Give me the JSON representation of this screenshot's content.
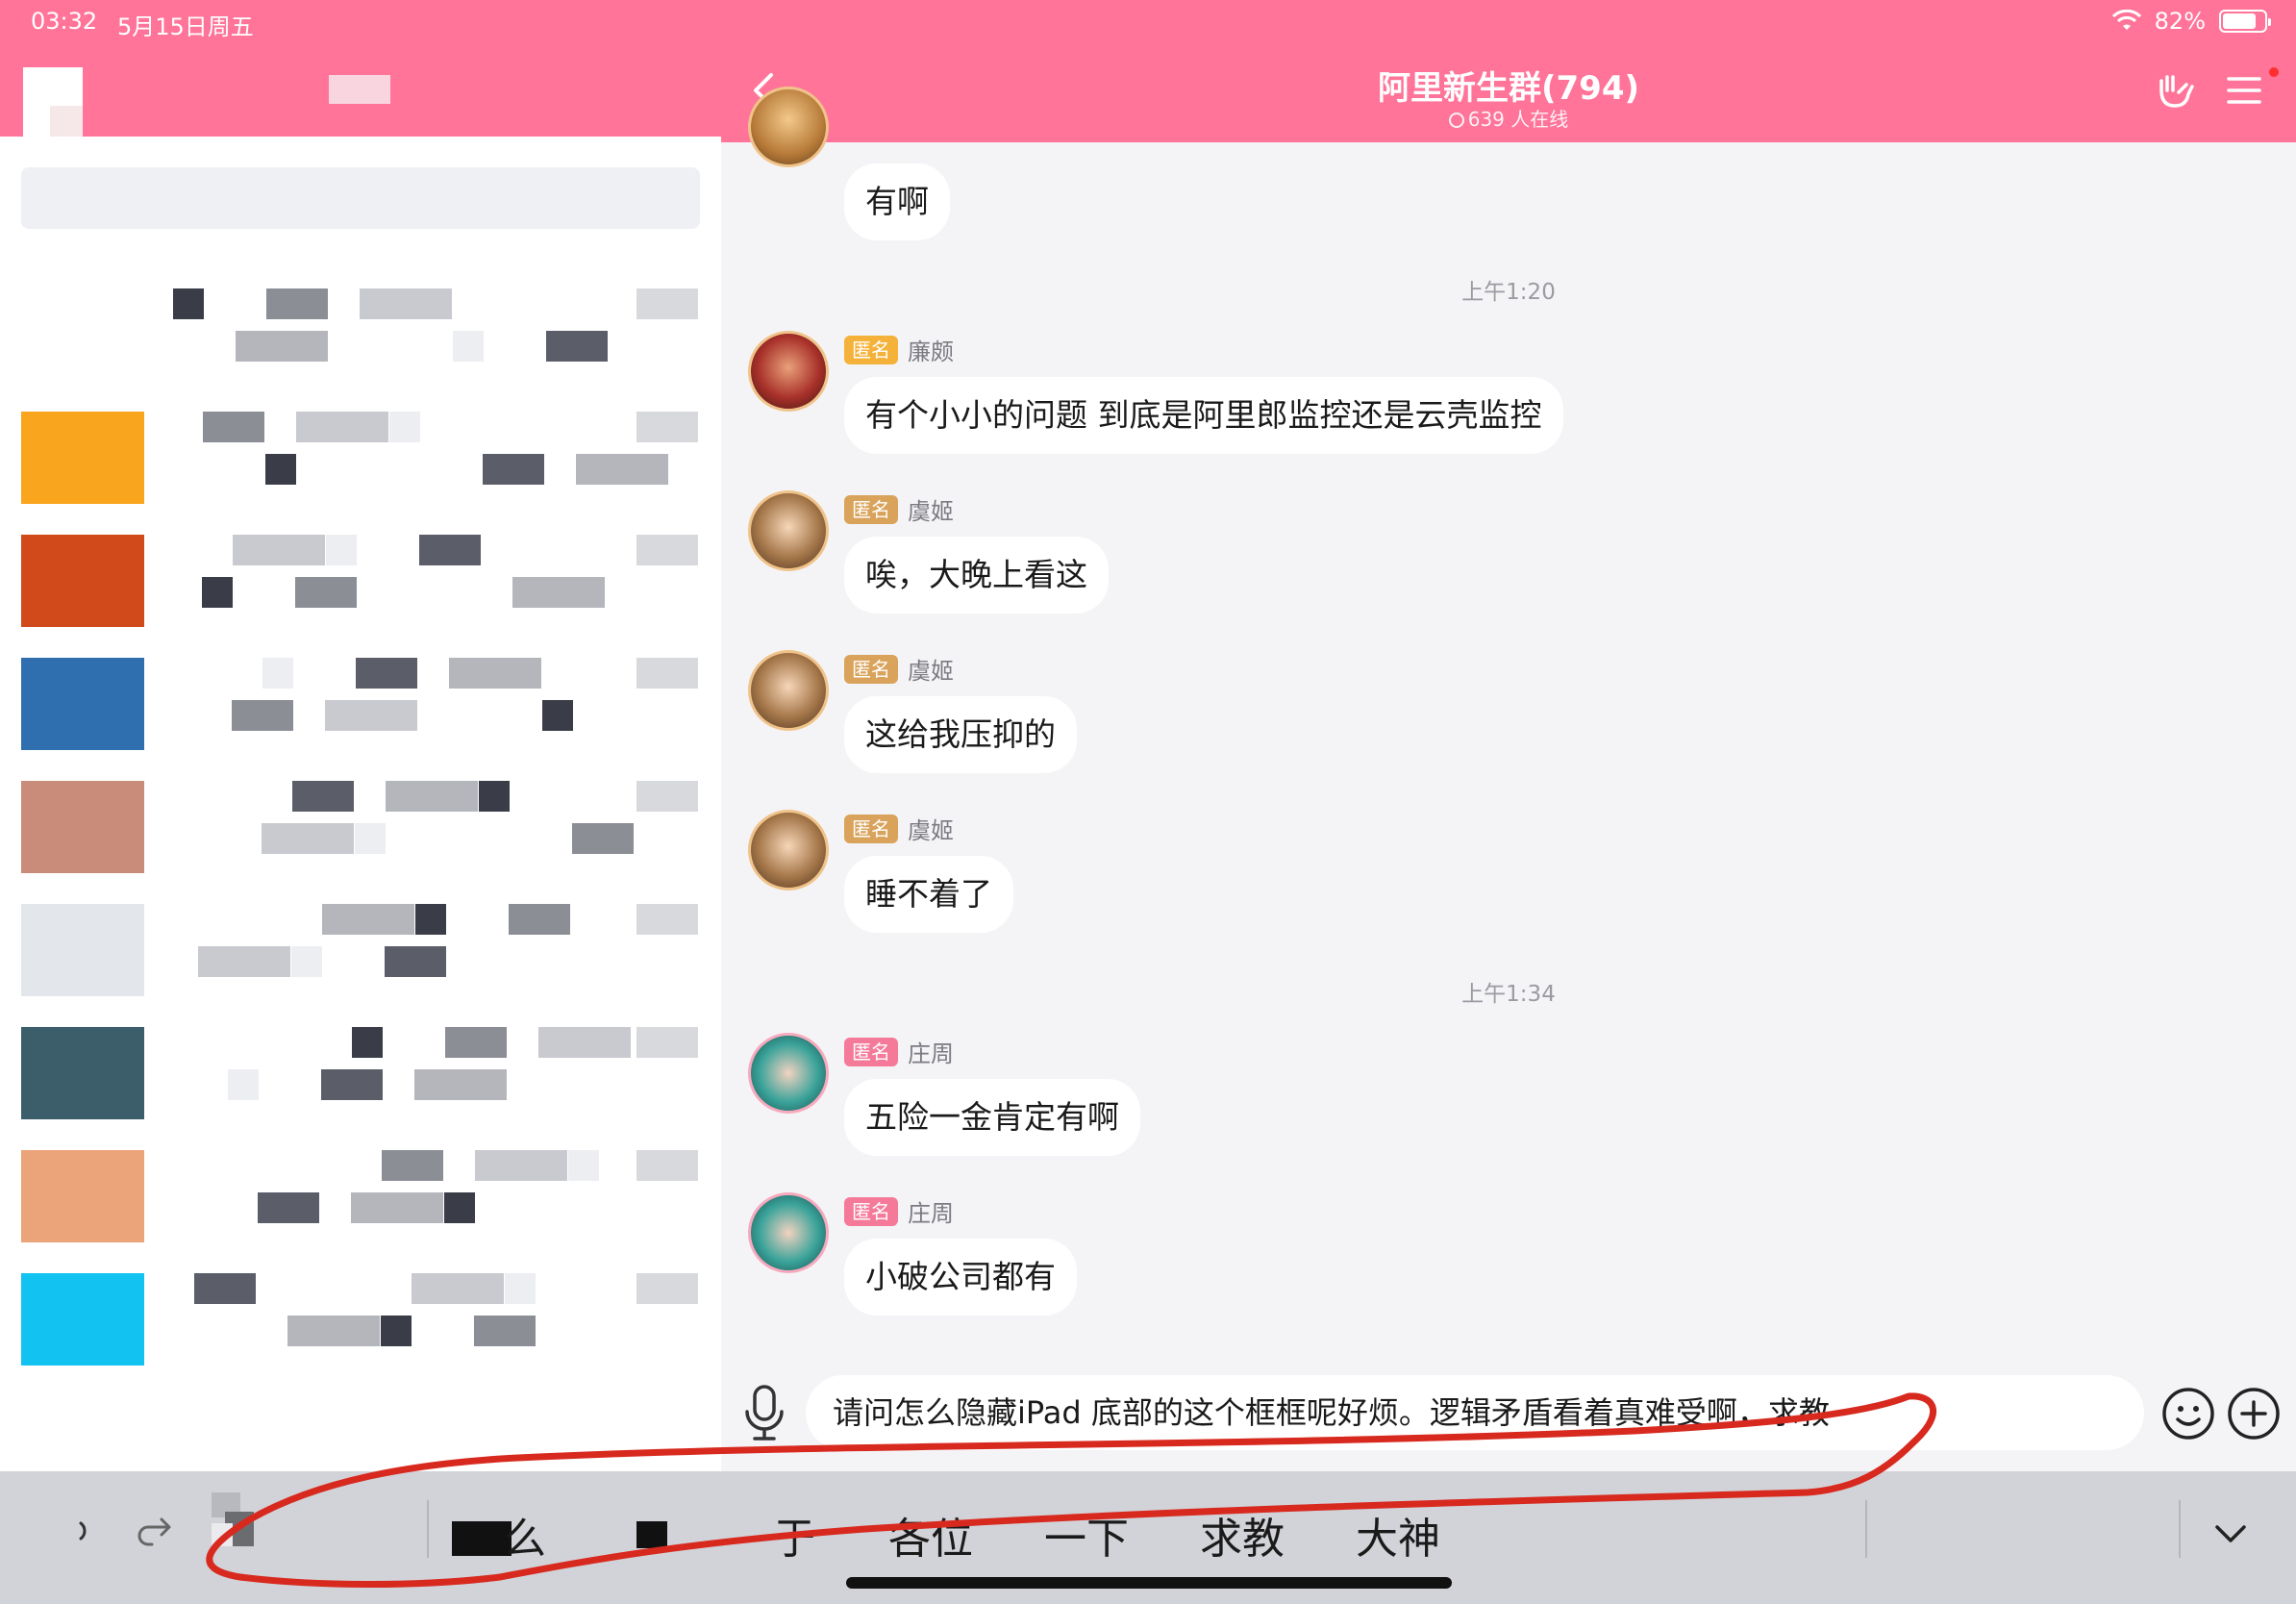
{
  "status_bar": {
    "time": "03:32",
    "date": "5月15日周五",
    "battery": "82%",
    "battery_level": 0.82
  },
  "left_pane": {
    "note": "",
    "rows": [
      {
        "avatar_color": "#ffffff"
      },
      {
        "avatar_color": "#f9a51e"
      },
      {
        "avatar_color": "#d04a1b"
      },
      {
        "avatar_color": "#2f6fb0"
      },
      {
        "avatar_color": "#c98c7a"
      },
      {
        "avatar_color": "#e3e6ea"
      },
      {
        "avatar_color": "#3c5d6a"
      },
      {
        "avatar_color": "#eba37a"
      },
      {
        "avatar_color": "#12c2f0"
      }
    ]
  },
  "chat": {
    "title": "阿里新生群(794)",
    "online": "639 人在线",
    "accent": "#ff7498",
    "times": [
      "上午1:20",
      "上午1:34"
    ],
    "messages": [
      {
        "sender": "",
        "tag": "",
        "text": "有啊",
        "avatar": "hero-gold"
      },
      {
        "sender": "廉颇",
        "tag": "匿名",
        "tag_color": "#f5b23a",
        "text": "有个小小的问题 到底是阿里郎监控还是云壳监控",
        "avatar": "hero-red"
      },
      {
        "sender": "虞姬",
        "tag": "匿名",
        "tag_color": "#d9a35c",
        "text": "唉，大晚上看这",
        "avatar": "hero-brown"
      },
      {
        "sender": "虞姬",
        "tag": "匿名",
        "tag_color": "#d9a35c",
        "text": "这给我压抑的",
        "avatar": "hero-brown"
      },
      {
        "sender": "虞姬",
        "tag": "匿名",
        "tag_color": "#d9a35c",
        "text": "睡不着了",
        "avatar": "hero-brown"
      },
      {
        "sender": "庄周",
        "tag": "匿名",
        "tag_color": "#f57a9a",
        "text": "五险一金肯定有啊",
        "avatar": "hero-teal"
      },
      {
        "sender": "庄周",
        "tag": "匿名",
        "tag_color": "#f57a9a",
        "text": "小破公司都有",
        "avatar": "hero-teal"
      }
    ]
  },
  "input": {
    "value": "请问怎么隐藏iPad 底部的这个框框呢好烦。逻辑矛盾看着真难受啊，求教"
  },
  "keyboard_bar": {
    "candidates": [
      "么",
      "于",
      "各位",
      "一下",
      "求教",
      "大神"
    ],
    "icons": [
      "undo-icon",
      "redo-icon",
      "clipboard-icon",
      "collapse-chevron-icon"
    ]
  },
  "annotation": {
    "color": "#d8291f"
  }
}
